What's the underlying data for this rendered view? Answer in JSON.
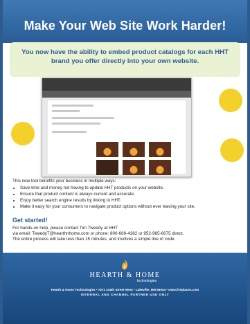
{
  "header": {
    "title": "Make Your Web Site Work Harder!"
  },
  "intro": {
    "text": "You now have the ability to embed product catalogs for each HHT brand you offer directly into your own website."
  },
  "benefits": {
    "lead": "This new tool benefits your business in multiple ways:",
    "items": [
      "Save time and money not having to update HHT products on your website.",
      "Ensure that product content is always current and accurate.",
      "Enjoy better search engine results by linking to HHT.",
      "Make it easy for your consumers to navigate product options without ever leaving your site."
    ]
  },
  "get_started": {
    "heading": "Get started!",
    "line1": "For hands-on help, please contact Tim Tweedy at HHT",
    "line2": "via email: TweedyT@hearthnhome.com or phone: 800-669-4382 or 952-985-6675 direct.",
    "line3": "The entire process will take less than 15 minutes, and involves a simple line of code."
  },
  "footer": {
    "brand": "HEARTH & HOME",
    "brand_sub": "technologies",
    "address": "Hearth & Home Technologies • 7571 215th Street West • Lakeville, MN 55044 • www.fireplaces.com",
    "notice": "INTERNAL AND CHANNEL PARTNER USE ONLY"
  },
  "colors": {
    "primary_blue": "#2b5b92",
    "accent_green": "#eaf2d4",
    "seal_yellow": "#f4d12a"
  },
  "icons": {
    "logo": "flame-icon"
  }
}
